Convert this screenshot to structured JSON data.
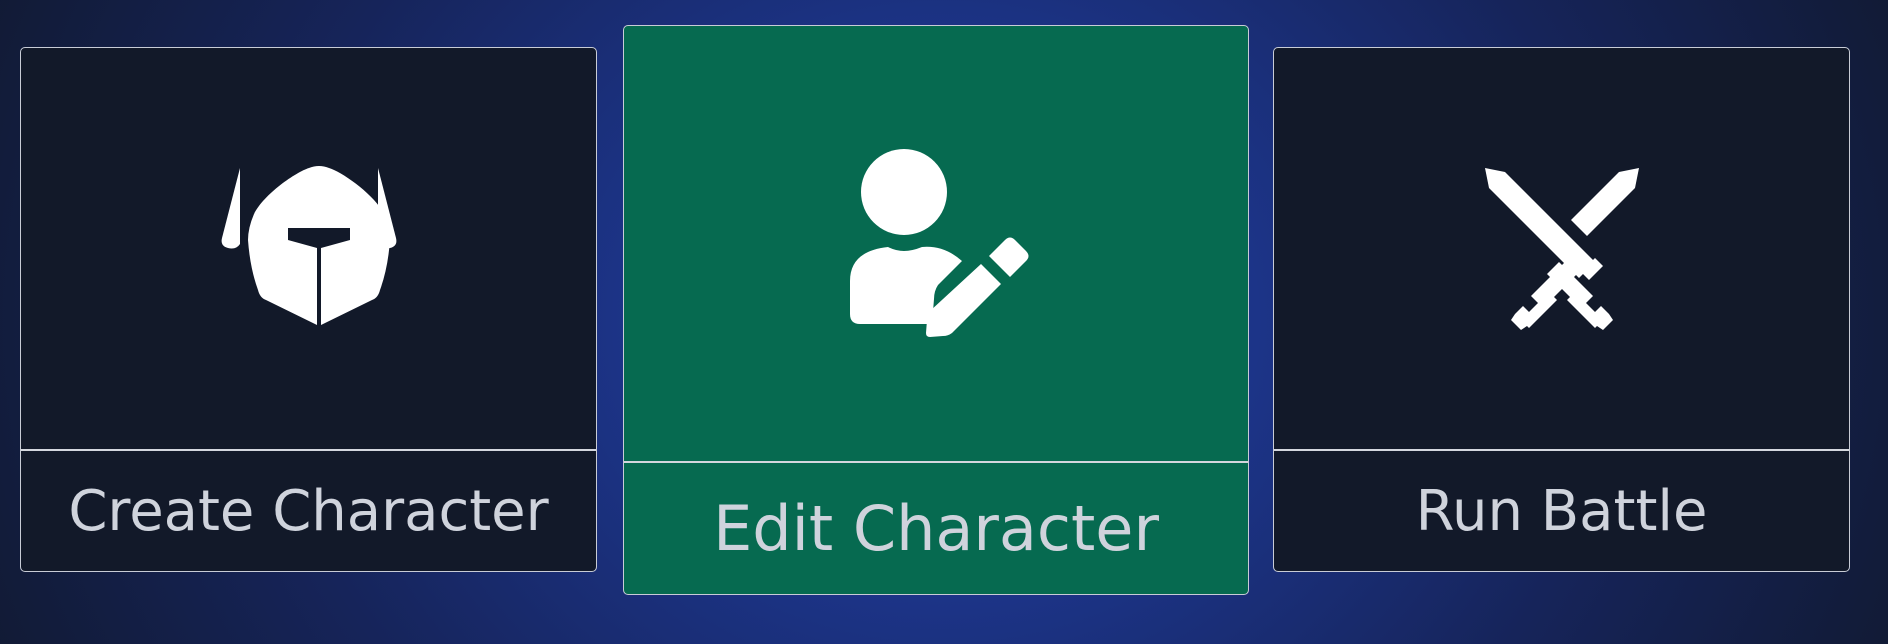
{
  "cards": [
    {
      "label": "Create Character",
      "icon": "helmet-icon"
    },
    {
      "label": "Edit Character",
      "icon": "user-pen-icon",
      "selected": true
    },
    {
      "label": "Run Battle",
      "icon": "crossed-swords-icon"
    }
  ],
  "colors": {
    "card_background": "#121929",
    "selected_background": "#066a50",
    "border": "#c8ccd6",
    "icon": "#ffffff",
    "label_text": "#cfd3dc"
  }
}
